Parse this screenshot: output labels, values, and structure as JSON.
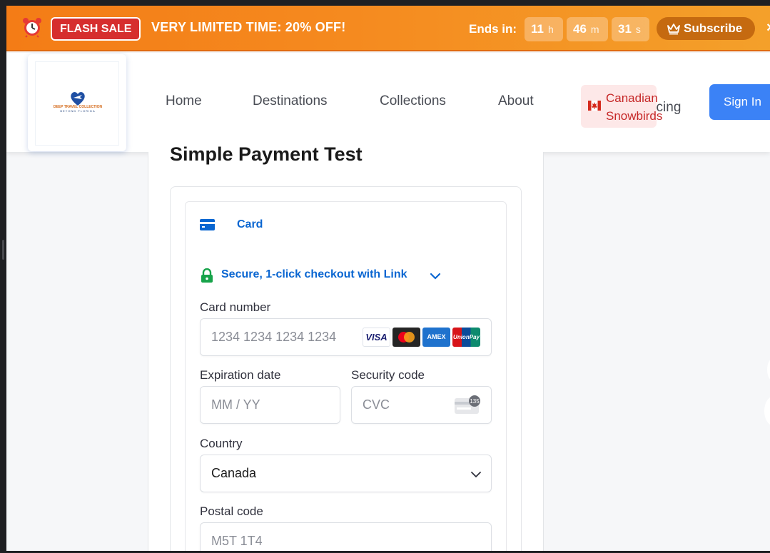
{
  "flash_bar": {
    "badge": "FLASH SALE",
    "headline": "VERY LIMITED TIME:  20% OFF!",
    "ends_label": "Ends in:",
    "timer": [
      {
        "value": "11",
        "unit": "h"
      },
      {
        "value": "46",
        "unit": "m"
      },
      {
        "value": "31",
        "unit": "s"
      }
    ],
    "subscribe_label": "Subscribe",
    "close_label": "×"
  },
  "header": {
    "logo_line1": "DEEP TRAVEL COLLECTION",
    "logo_line2": "BEYOND FLORIDA",
    "nav": [
      "Home",
      "Destinations",
      "Collections",
      "About"
    ],
    "canadian_line1": "Canadian",
    "canadian_line2": "Snowbirds",
    "pricing_partial": "ricing",
    "signin_label": "Sign In"
  },
  "page": {
    "title": "Simple Payment Test"
  },
  "payment": {
    "tab_label": "Card",
    "link_text": "Secure, 1-click checkout with Link",
    "card_number": {
      "label": "Card number",
      "placeholder": "1234 1234 1234 1234"
    },
    "brands": [
      "VISA",
      "mastercard",
      "AMEX",
      "UnionPay"
    ],
    "expiry": {
      "label": "Expiration date",
      "placeholder": "MM / YY"
    },
    "cvc": {
      "label": "Security code",
      "placeholder": "CVC",
      "icon_text": "135"
    },
    "country": {
      "label": "Country",
      "value": "Canada"
    },
    "postal": {
      "label": "Postal code",
      "placeholder": "M5T 1T4"
    }
  },
  "colors": {
    "flash_orange": "#f58a1f",
    "flash_red": "#d62e2e",
    "link_blue": "#0a66d1",
    "signin_blue": "#3b82f6",
    "canadian_red": "#c62828"
  }
}
